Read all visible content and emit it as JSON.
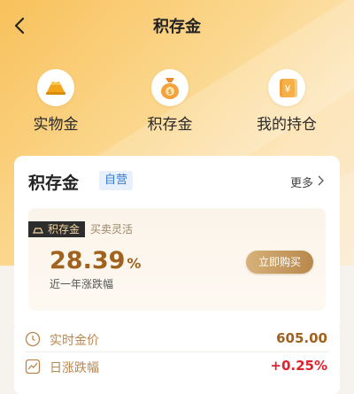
{
  "header": {
    "title": "积存金"
  },
  "entries": [
    {
      "label": "实物金",
      "icon": "gold-bar-icon"
    },
    {
      "label": "积存金",
      "icon": "money-bag-icon"
    },
    {
      "label": "我的持仓",
      "icon": "holdings-icon"
    }
  ],
  "section": {
    "title": "积存金",
    "tag": "自营",
    "more": "更多"
  },
  "product": {
    "ribbon": "积存金",
    "subtitle": "买卖灵活",
    "rate_value": "28.39",
    "rate_unit": "%",
    "rate_label": "近一年涨跌幅",
    "buy_label": "立即购买"
  },
  "market": {
    "price_label": "实时金价",
    "price_value": "605.00",
    "change_label": "日涨跌幅",
    "change_value": "+0.25%"
  },
  "colors": {
    "accent_gold": "#a0621d",
    "up_red": "#e0222d",
    "tag_blue": "#3a79c9"
  }
}
